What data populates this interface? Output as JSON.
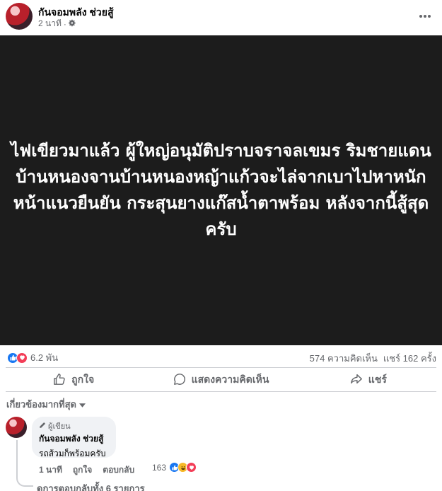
{
  "post": {
    "page_name": "กันจอมพลัง ช่วยสู้",
    "time": "2 นาที",
    "separator": "·",
    "privacy_icon": "gear-icon",
    "more_icon": "more-horizontal-icon",
    "text": "ไฟเขียวมาแล้ว ผู้ใหญ่อนุมัติปราบจราจลเขมร ริมชายแดนบ้านหนองจานบ้านหนองหญ้าแก้วจะไล่จากเบาไปหาหนักหน้าแนวยืนยัน กระสุนยางแก๊สน้ำตาพร้อม หลังจากนี้สู้สุดครับ",
    "background_color": "#1c1c1c"
  },
  "stats": {
    "reaction_count": "6.2 พัน",
    "comments": "574 ความคิดเห็น",
    "shares": "แชร์ 162 ครั้ง"
  },
  "actions": {
    "like": "ถูกใจ",
    "comment": "แสดงความคิดเห็น",
    "share": "แชร์"
  },
  "comments_section": {
    "sort_label": "เกี่ยวข้องมากที่สุด",
    "comment": {
      "badge": "ผู้เขียน",
      "author": "กันจอมพลัง ช่วยสู้",
      "text": "รถส้วมก็พร้อมครับ",
      "time": "1 นาที",
      "like": "ถูกใจ",
      "reply": "ตอบกลับ",
      "reaction_count": "163"
    },
    "view_replies": "ดูการตอบกลับทั้ง 6 รายการ"
  },
  "colors": {
    "like_blue": "#1877f2",
    "love_red": "#f33e58",
    "haha_yellow": "#f7b928",
    "muted_text": "#65676b"
  }
}
